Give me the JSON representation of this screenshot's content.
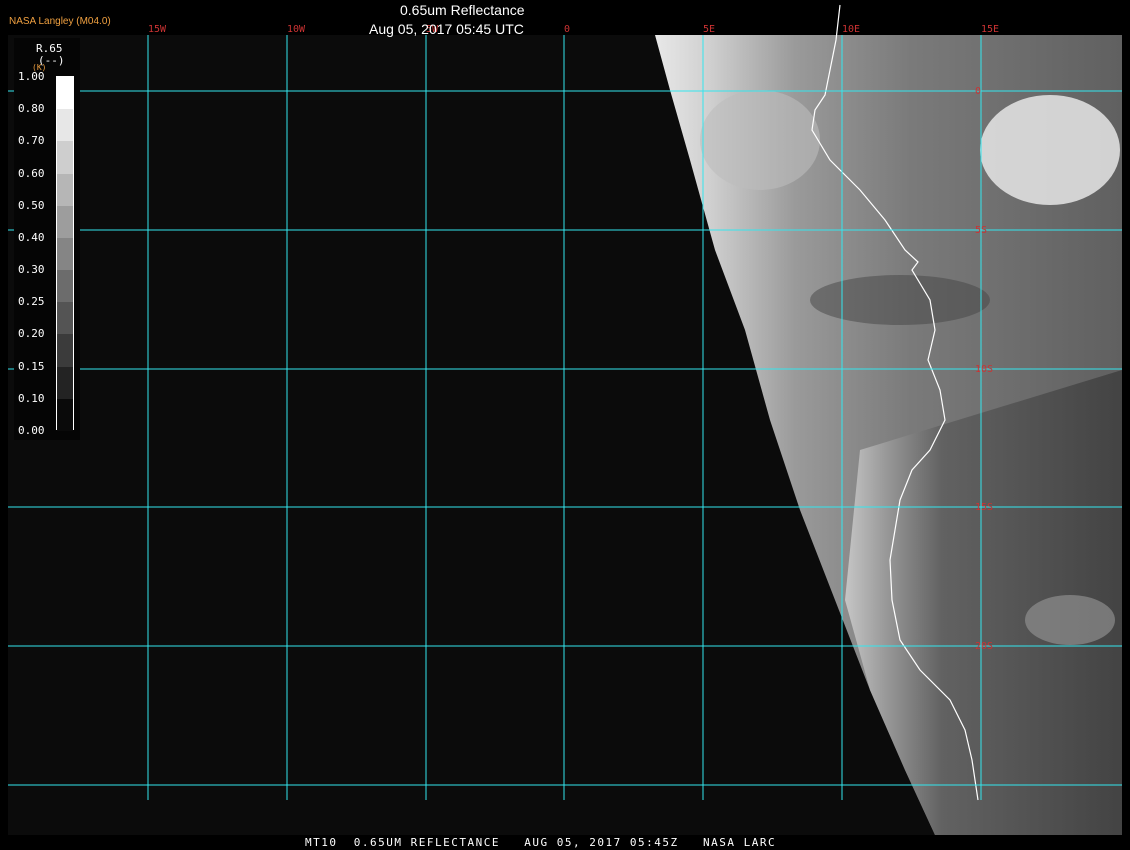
{
  "header": {
    "brand": "NASA Langley (M04.0)",
    "title": "0.65um Reflectance",
    "subtitle": "Aug 05, 2017 05:45 UTC"
  },
  "footer": {
    "text": "MT10  0.65UM REFLECTANCE   AUG 05, 2017 05:45Z   NASA LARC"
  },
  "legend": {
    "product": "R.65",
    "units": "(--)",
    "unit_small": "(K)",
    "ticks": [
      "1.00",
      "0.80",
      "0.70",
      "0.60",
      "0.50",
      "0.40",
      "0.30",
      "0.25",
      "0.20",
      "0.15",
      "0.10",
      "0.00"
    ]
  },
  "grid": {
    "longitudes": [
      "15W",
      "10W",
      "5W",
      "0",
      "5E",
      "10E",
      "15E"
    ],
    "latitudes": [
      "0",
      "5S",
      "10S",
      "15S",
      "20S"
    ]
  },
  "colors": {
    "gridline": "#33e6ee",
    "grid_label": "#cc3333",
    "brand": "#f0a040",
    "background": "#0a0a0a"
  }
}
